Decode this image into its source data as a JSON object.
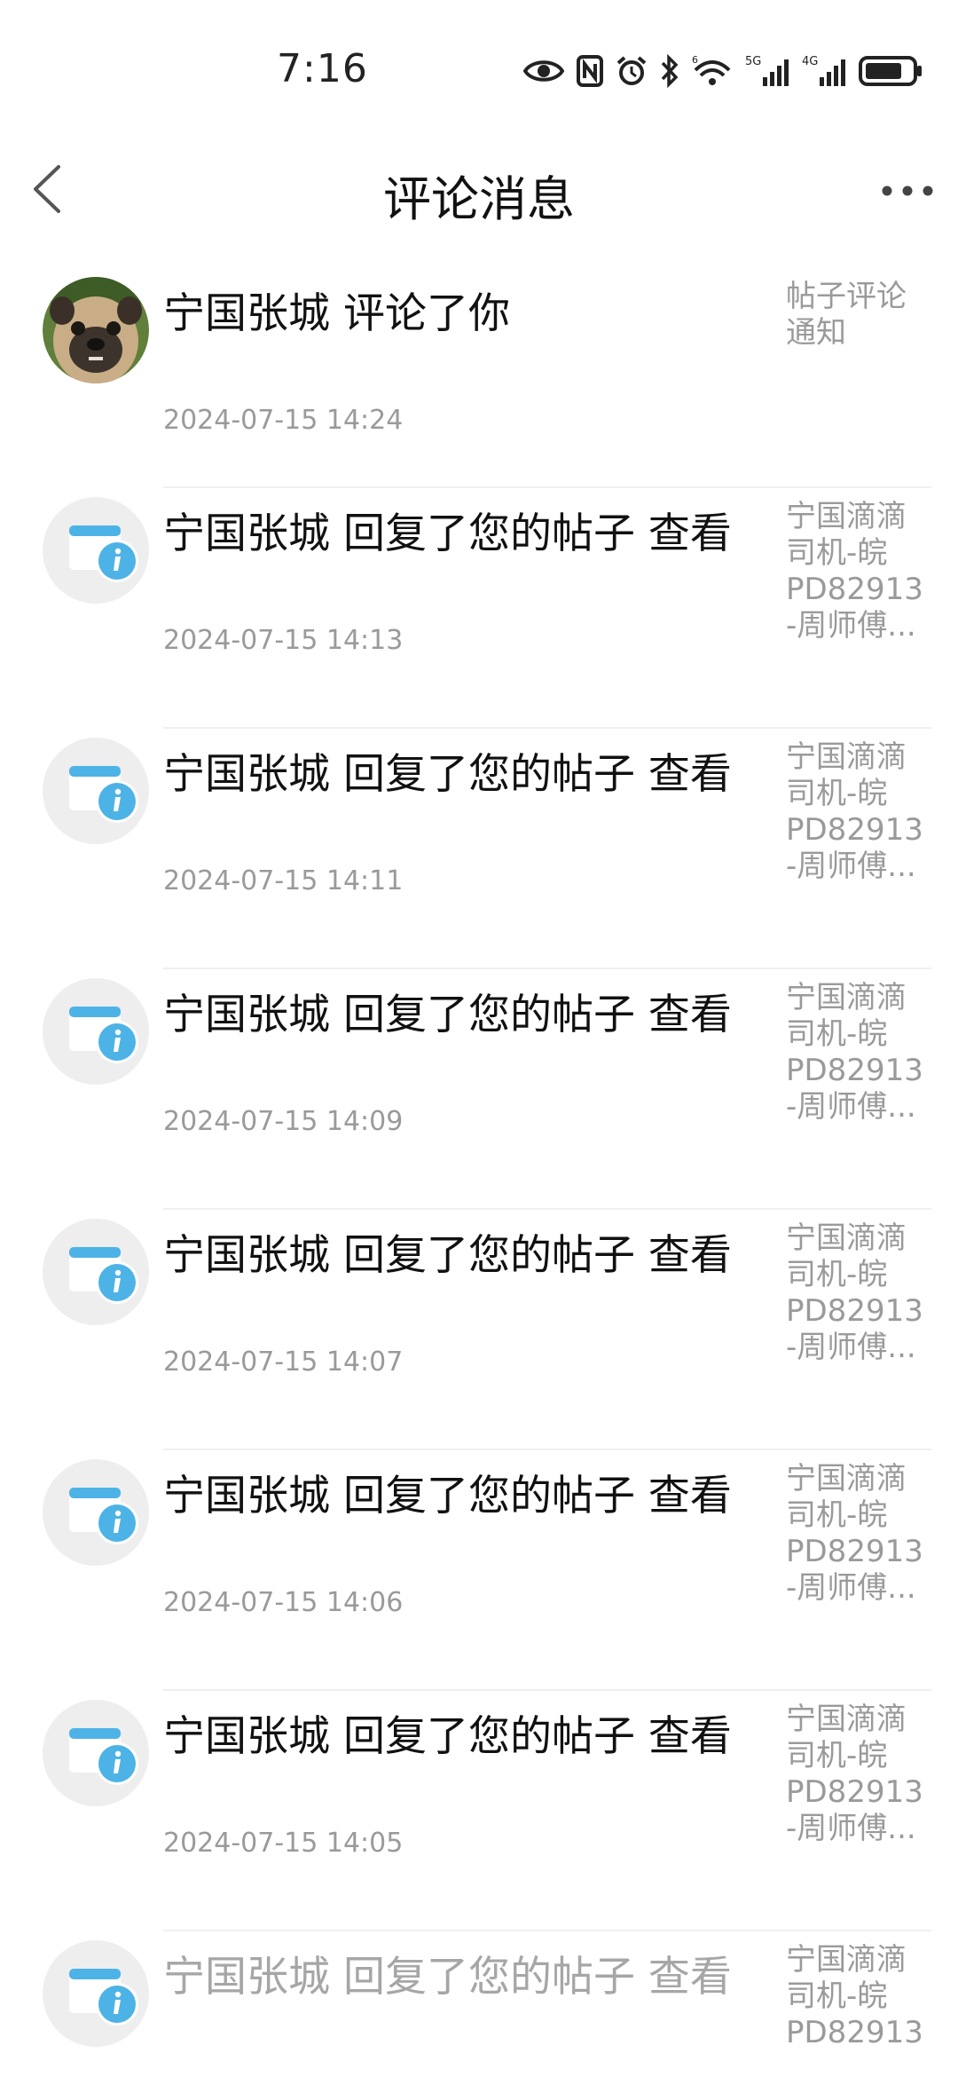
{
  "status_bar": {
    "time": "7:16",
    "icons": [
      "eye-icon",
      "nfc-icon",
      "alarm-icon",
      "bluetooth-icon",
      "wifi-6-icon",
      "signal-5g-icon",
      "signal-4g-icon",
      "battery-icon"
    ],
    "wifi_label": "6",
    "net1_label": "5G",
    "net2_label": "4G"
  },
  "header": {
    "title": "评论消息",
    "back_icon": "chevron-left-icon",
    "more_icon": "more-dots-icon"
  },
  "messages": [
    {
      "avatar": "pug-photo",
      "title": "宁国张城 评论了你",
      "time": "2024-07-15 14:24",
      "source_lines": [
        "帖子评论",
        "通知"
      ]
    },
    {
      "avatar": "info-icon",
      "title": "宁国张城 回复了您的帖子 查看",
      "time": "2024-07-15 14:13",
      "source_lines": [
        "宁国滴滴",
        "司机-皖",
        "PD82913",
        "-周师傅..."
      ]
    },
    {
      "avatar": "info-icon",
      "title": "宁国张城 回复了您的帖子 查看",
      "time": "2024-07-15 14:11",
      "source_lines": [
        "宁国滴滴",
        "司机-皖",
        "PD82913",
        "-周师傅..."
      ]
    },
    {
      "avatar": "info-icon",
      "title": "宁国张城 回复了您的帖子 查看",
      "time": "2024-07-15 14:09",
      "source_lines": [
        "宁国滴滴",
        "司机-皖",
        "PD82913",
        "-周师傅..."
      ]
    },
    {
      "avatar": "info-icon",
      "title": "宁国张城 回复了您的帖子 查看",
      "time": "2024-07-15 14:07",
      "source_lines": [
        "宁国滴滴",
        "司机-皖",
        "PD82913",
        "-周师傅..."
      ]
    },
    {
      "avatar": "info-icon",
      "title": "宁国张城 回复了您的帖子 查看",
      "time": "2024-07-15 14:06",
      "source_lines": [
        "宁国滴滴",
        "司机-皖",
        "PD82913",
        "-周师傅..."
      ]
    },
    {
      "avatar": "info-icon",
      "title": "宁国张城 回复了您的帖子 查看",
      "time": "2024-07-15 14:05",
      "source_lines": [
        "宁国滴滴",
        "司机-皖",
        "PD82913",
        "-周师傅..."
      ]
    },
    {
      "avatar": "info-icon",
      "title": "宁国张城 回复了您的帖子 查看",
      "time": "",
      "source_lines": [
        "宁国滴滴",
        "司机-皖",
        "PD82913"
      ]
    }
  ],
  "colors": {
    "info_blue": "#4db3e6",
    "avatar_bg": "#eeeeee",
    "muted_text": "#9a9a9a"
  }
}
